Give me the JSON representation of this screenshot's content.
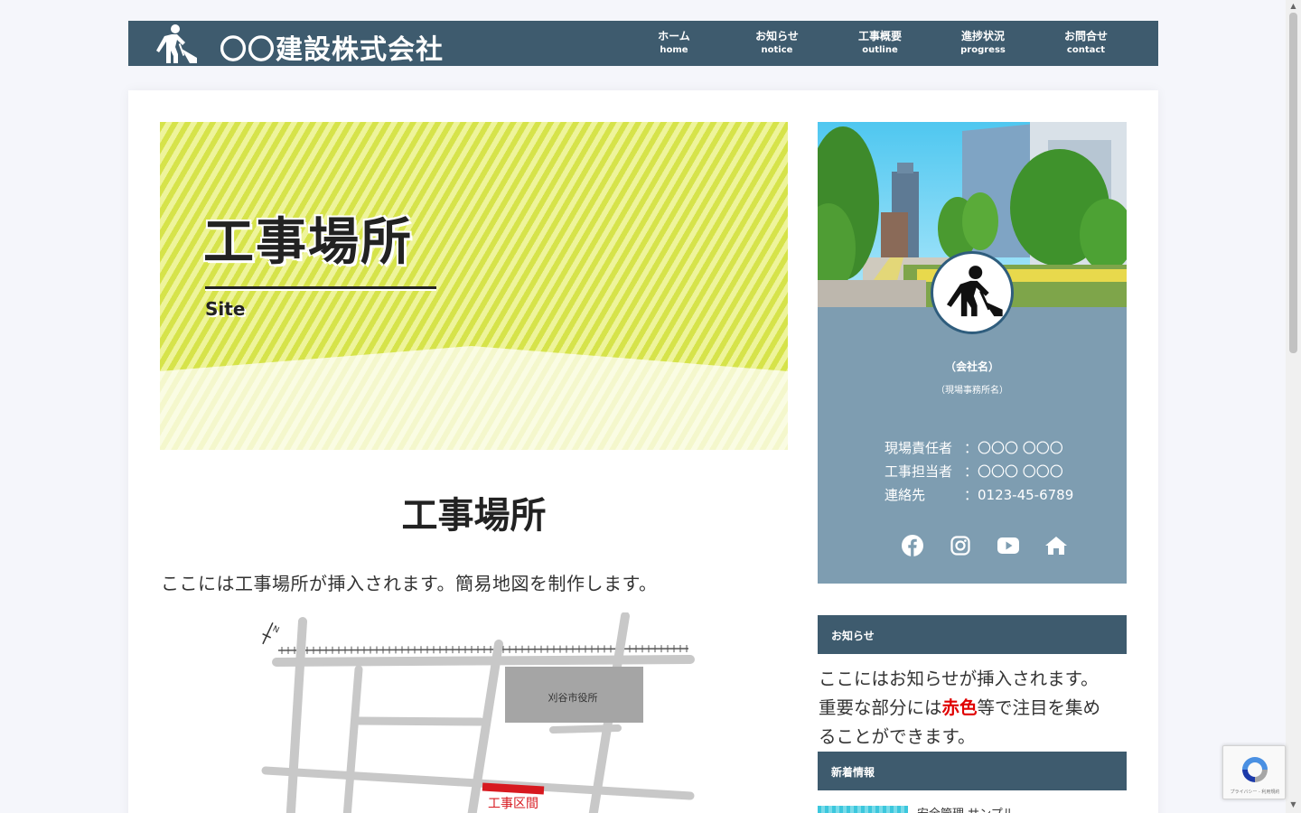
{
  "header": {
    "site_title": "〇〇建設株式会社",
    "nav": [
      {
        "jp": "ホーム",
        "en": "home"
      },
      {
        "jp": "お知らせ",
        "en": "notice"
      },
      {
        "jp": "工事概要",
        "en": "outline"
      },
      {
        "jp": "進捗状況",
        "en": "progress"
      },
      {
        "jp": "お問合せ",
        "en": "contact"
      }
    ]
  },
  "hero": {
    "title": "工事場所",
    "subtitle": "Site"
  },
  "main": {
    "heading": "工事場所",
    "description": "ここには工事場所が挿入されます。簡易地図を制作します。",
    "map": {
      "north_label": "N",
      "building_label": "刈谷市役所",
      "construction_label": "工事区間"
    }
  },
  "profile": {
    "company": "（会社名）",
    "office": "（現場事務所名）",
    "rows": [
      {
        "key": "現場責任者",
        "value": "：〇〇〇 〇〇〇"
      },
      {
        "key": "工事担当者",
        "value": "：〇〇〇 〇〇〇"
      },
      {
        "key": "連絡先",
        "value": "：0123-45-6789"
      }
    ],
    "socials": [
      "facebook-icon",
      "instagram-icon",
      "youtube-icon",
      "home-icon"
    ]
  },
  "notice": {
    "heading": "お知らせ",
    "line1": "ここにはお知らせが挿入されます。",
    "line2_before": "重要な部分には",
    "line2_red": "赤色",
    "line2_after": "等で注目を集め",
    "line3": "ることができます。"
  },
  "news": {
    "heading": "新着情報",
    "first_title": "安全管理 サンプル"
  },
  "recaptcha": {
    "terms": "プライバシー - 利用規約"
  },
  "colors": {
    "header_bg": "#3e5b6e",
    "profile_bg": "#7e9db1",
    "hero_stripe": "#d6e34a",
    "highlight_red": "#e00000",
    "construction_red": "#d7191f"
  }
}
